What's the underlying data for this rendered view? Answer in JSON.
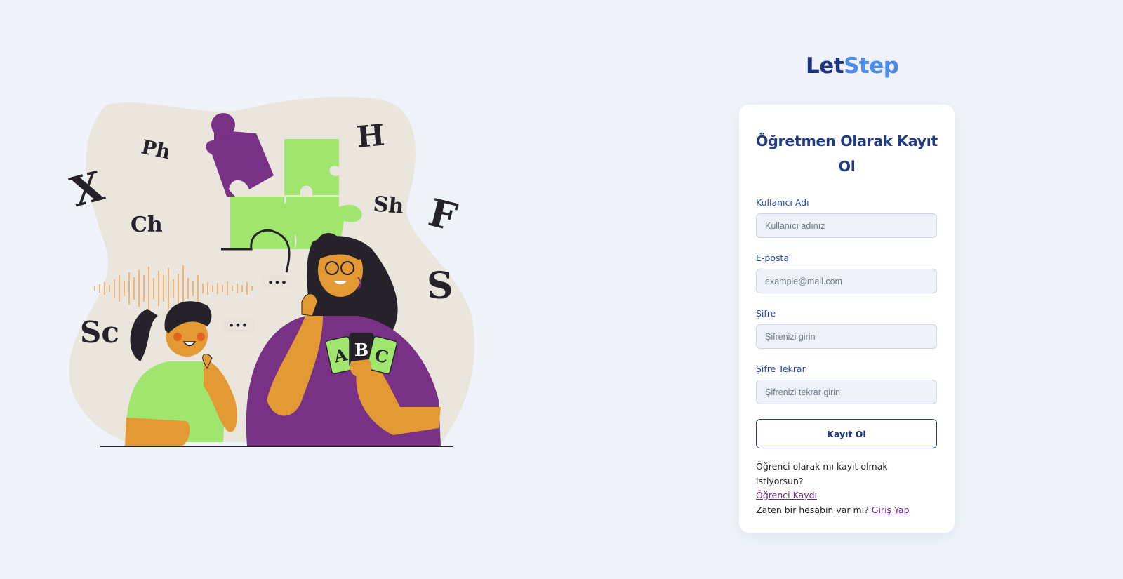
{
  "brand": {
    "part1": "Let",
    "part2": "Step",
    "color_part1": "#1e3480",
    "color_part2": "#4a8cf0"
  },
  "form": {
    "title": "Öğretmen Olarak Kayıt Ol",
    "fields": [
      {
        "label": "Kullanıcı Adı",
        "placeholder": "Kullanıcı adınız",
        "type": "text"
      },
      {
        "label": "E-posta",
        "placeholder": "example@mail.com",
        "type": "email"
      },
      {
        "label": "Şifre",
        "placeholder": "Şifrenizi girin",
        "type": "password"
      },
      {
        "label": "Şifre Tekrar",
        "placeholder": "Şifrenizi tekrar girin",
        "type": "password"
      }
    ],
    "submit_label": "Kayıt Ol"
  },
  "links": {
    "student_question": "Öğrenci olarak mı kayıt olmak istiyorsun?",
    "student_link": "Öğrenci Kaydı",
    "login_question": "Zaten bir hesabın var mı?",
    "login_link": "Giriş Yap"
  },
  "illustration": {
    "letters": [
      "X",
      "Ph",
      "Ch",
      "H",
      "Sh",
      "F",
      "S",
      "Sc"
    ],
    "cards": [
      "A",
      "B",
      "C"
    ],
    "speech_bubble_text": "•••",
    "colors": {
      "blob": "#ebe6dd",
      "green": "#9fe56e",
      "purple": "#783184",
      "skin": "#e49a34",
      "hair": "#26222a",
      "wave": "#efb777"
    }
  }
}
